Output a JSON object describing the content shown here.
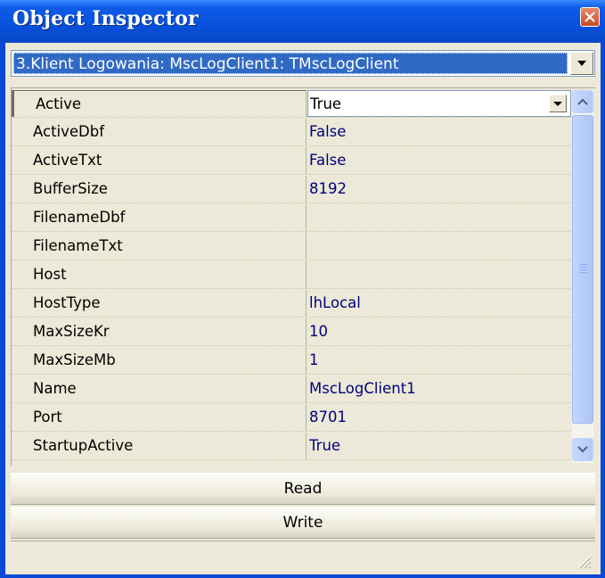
{
  "window": {
    "title": "Object Inspector"
  },
  "object_selector": {
    "value": "3.Klient Logowania: MscLogClient1: TMscLogClient"
  },
  "properties": [
    {
      "name": "Active",
      "value": "True",
      "selected": true
    },
    {
      "name": "ActiveDbf",
      "value": "False"
    },
    {
      "name": "ActiveTxt",
      "value": "False"
    },
    {
      "name": "BufferSize",
      "value": "8192"
    },
    {
      "name": "FilenameDbf",
      "value": ""
    },
    {
      "name": "FilenameTxt",
      "value": ""
    },
    {
      "name": "Host",
      "value": ""
    },
    {
      "name": "HostType",
      "value": "lhLocal"
    },
    {
      "name": "MaxSizeKr",
      "value": "10"
    },
    {
      "name": "MaxSizeMb",
      "value": "1"
    },
    {
      "name": "Name",
      "value": "MscLogClient1"
    },
    {
      "name": "Port",
      "value": "8701"
    },
    {
      "name": "StartupActive",
      "value": "True"
    }
  ],
  "buttons": {
    "read": "Read",
    "write": "Write"
  },
  "colors": {
    "titlebar": "#0750DB",
    "value_text": "#000080",
    "selection": "#316AC5",
    "face": "#ECE9D8"
  }
}
